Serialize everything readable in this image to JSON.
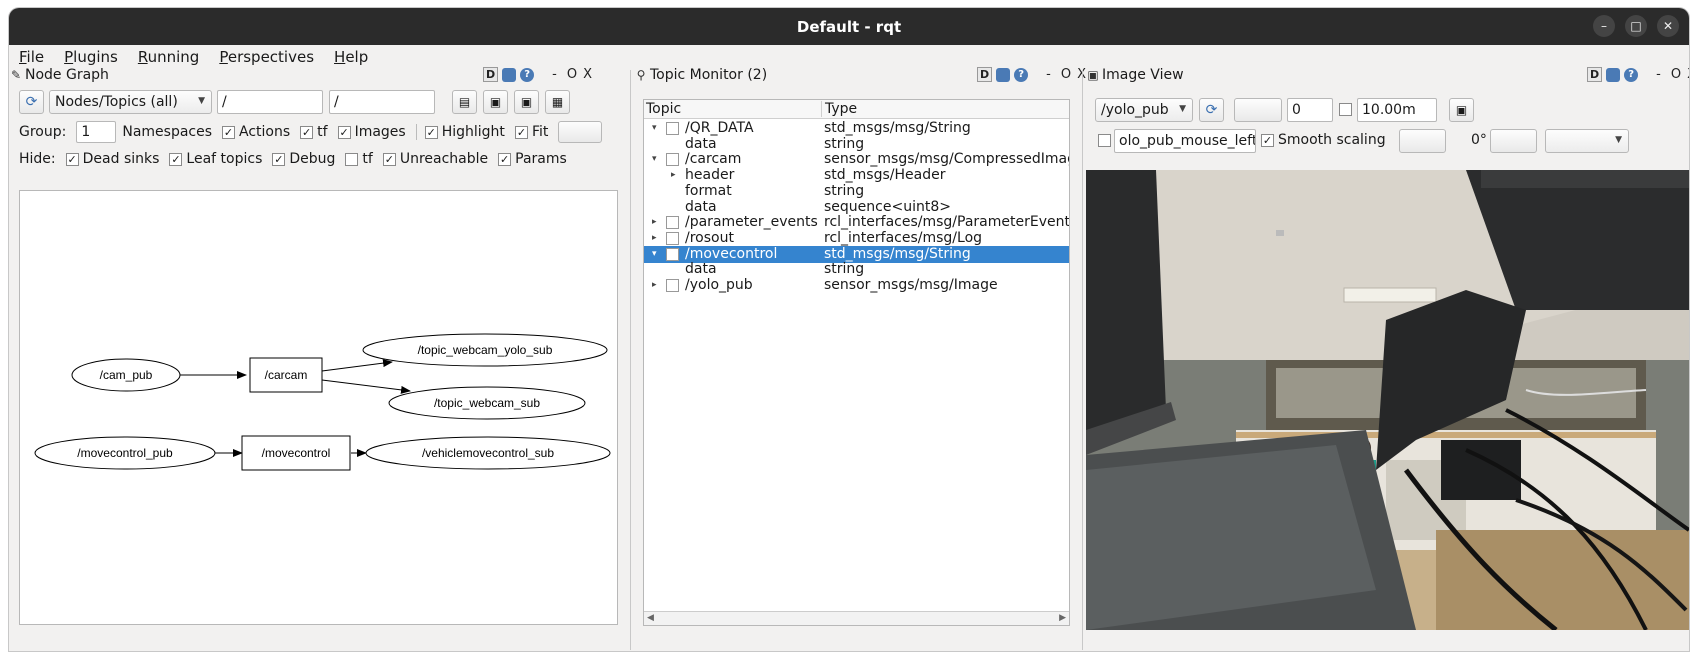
{
  "window": {
    "title": "Default - rqt"
  },
  "menu": [
    "File",
    "Plugins",
    "Running",
    "Perspectives",
    "Help"
  ],
  "node_graph": {
    "title": "Node Graph",
    "dock_ctrls": {
      "d": "D",
      "minus": "-",
      "o": "O",
      "x": "X"
    },
    "filter_combo": "Nodes/Topics (all)",
    "filter1": "/",
    "filter2": "/",
    "group_label": "Group:",
    "group_value": "1",
    "opts1": [
      {
        "label": "Namespaces",
        "checked": false
      },
      {
        "label": "Actions",
        "checked": true
      },
      {
        "label": "tf",
        "checked": true
      },
      {
        "label": "Images",
        "checked": true
      },
      {
        "label": "Highlight",
        "checked": true
      },
      {
        "label": "Fit",
        "checked": true
      }
    ],
    "hide_label": "Hide:",
    "hide_opts": [
      {
        "label": "Dead sinks",
        "checked": true
      },
      {
        "label": "Leaf topics",
        "checked": true
      },
      {
        "label": "Debug",
        "checked": true
      },
      {
        "label": "tf",
        "checked": false
      },
      {
        "label": "Unreachable",
        "checked": true
      },
      {
        "label": "Params",
        "checked": true
      }
    ],
    "graph_nodes": [
      "/cam_pub",
      "/carcam",
      "/topic_webcam_yolo_sub",
      "/topic_webcam_sub",
      "/movecontrol_pub",
      "/movecontrol",
      "/vehiclemovecontrol_sub"
    ]
  },
  "topic_monitor": {
    "title": "Topic Monitor (2)",
    "dock_ctrls": {
      "d": "D",
      "minus": "-",
      "o": "O",
      "x": "X"
    },
    "col_topic": "Topic",
    "col_type": "Type",
    "rows": [
      {
        "name": "/QR_DATA",
        "type": "std_msgs/msg/String",
        "level": 0,
        "tw": "▾",
        "cb": true,
        "sel": false
      },
      {
        "name": "data",
        "type": "string",
        "level": 1,
        "tw": "",
        "cb": false,
        "sel": false
      },
      {
        "name": "/carcam",
        "type": "sensor_msgs/msg/CompressedImage",
        "level": 0,
        "tw": "▾",
        "cb": true,
        "sel": false
      },
      {
        "name": "header",
        "type": "std_msgs/Header",
        "level": 1,
        "tw": "▸",
        "cb": false,
        "sel": false
      },
      {
        "name": "format",
        "type": "string",
        "level": 1,
        "tw": "",
        "cb": false,
        "sel": false
      },
      {
        "name": "data",
        "type": "sequence<uint8>",
        "level": 1,
        "tw": "",
        "cb": false,
        "sel": false
      },
      {
        "name": "/parameter_events",
        "type": "rcl_interfaces/msg/ParameterEvent",
        "level": 0,
        "tw": "▸",
        "cb": true,
        "sel": false
      },
      {
        "name": "/rosout",
        "type": "rcl_interfaces/msg/Log",
        "level": 0,
        "tw": "▸",
        "cb": true,
        "sel": false
      },
      {
        "name": "/movecontrol",
        "type": "std_msgs/msg/String",
        "level": 0,
        "tw": "▾",
        "cb": true,
        "sel": true
      },
      {
        "name": "data",
        "type": "string",
        "level": 1,
        "tw": "",
        "cb": false,
        "sel": false
      },
      {
        "name": "/yolo_pub",
        "type": "sensor_msgs/msg/Image",
        "level": 0,
        "tw": "▸",
        "cb": true,
        "sel": false
      }
    ]
  },
  "image_view": {
    "title": "Image View",
    "dock_ctrls": {
      "d": "D",
      "minus": "-",
      "o": "O",
      "x": "X"
    },
    "topic": "/yolo_pub",
    "spin_value": "0",
    "max_value": "10.00m",
    "mouse_topic": "olo_pub_mouse_left",
    "smooth_label": "Smooth scaling",
    "rotation": "0°"
  }
}
